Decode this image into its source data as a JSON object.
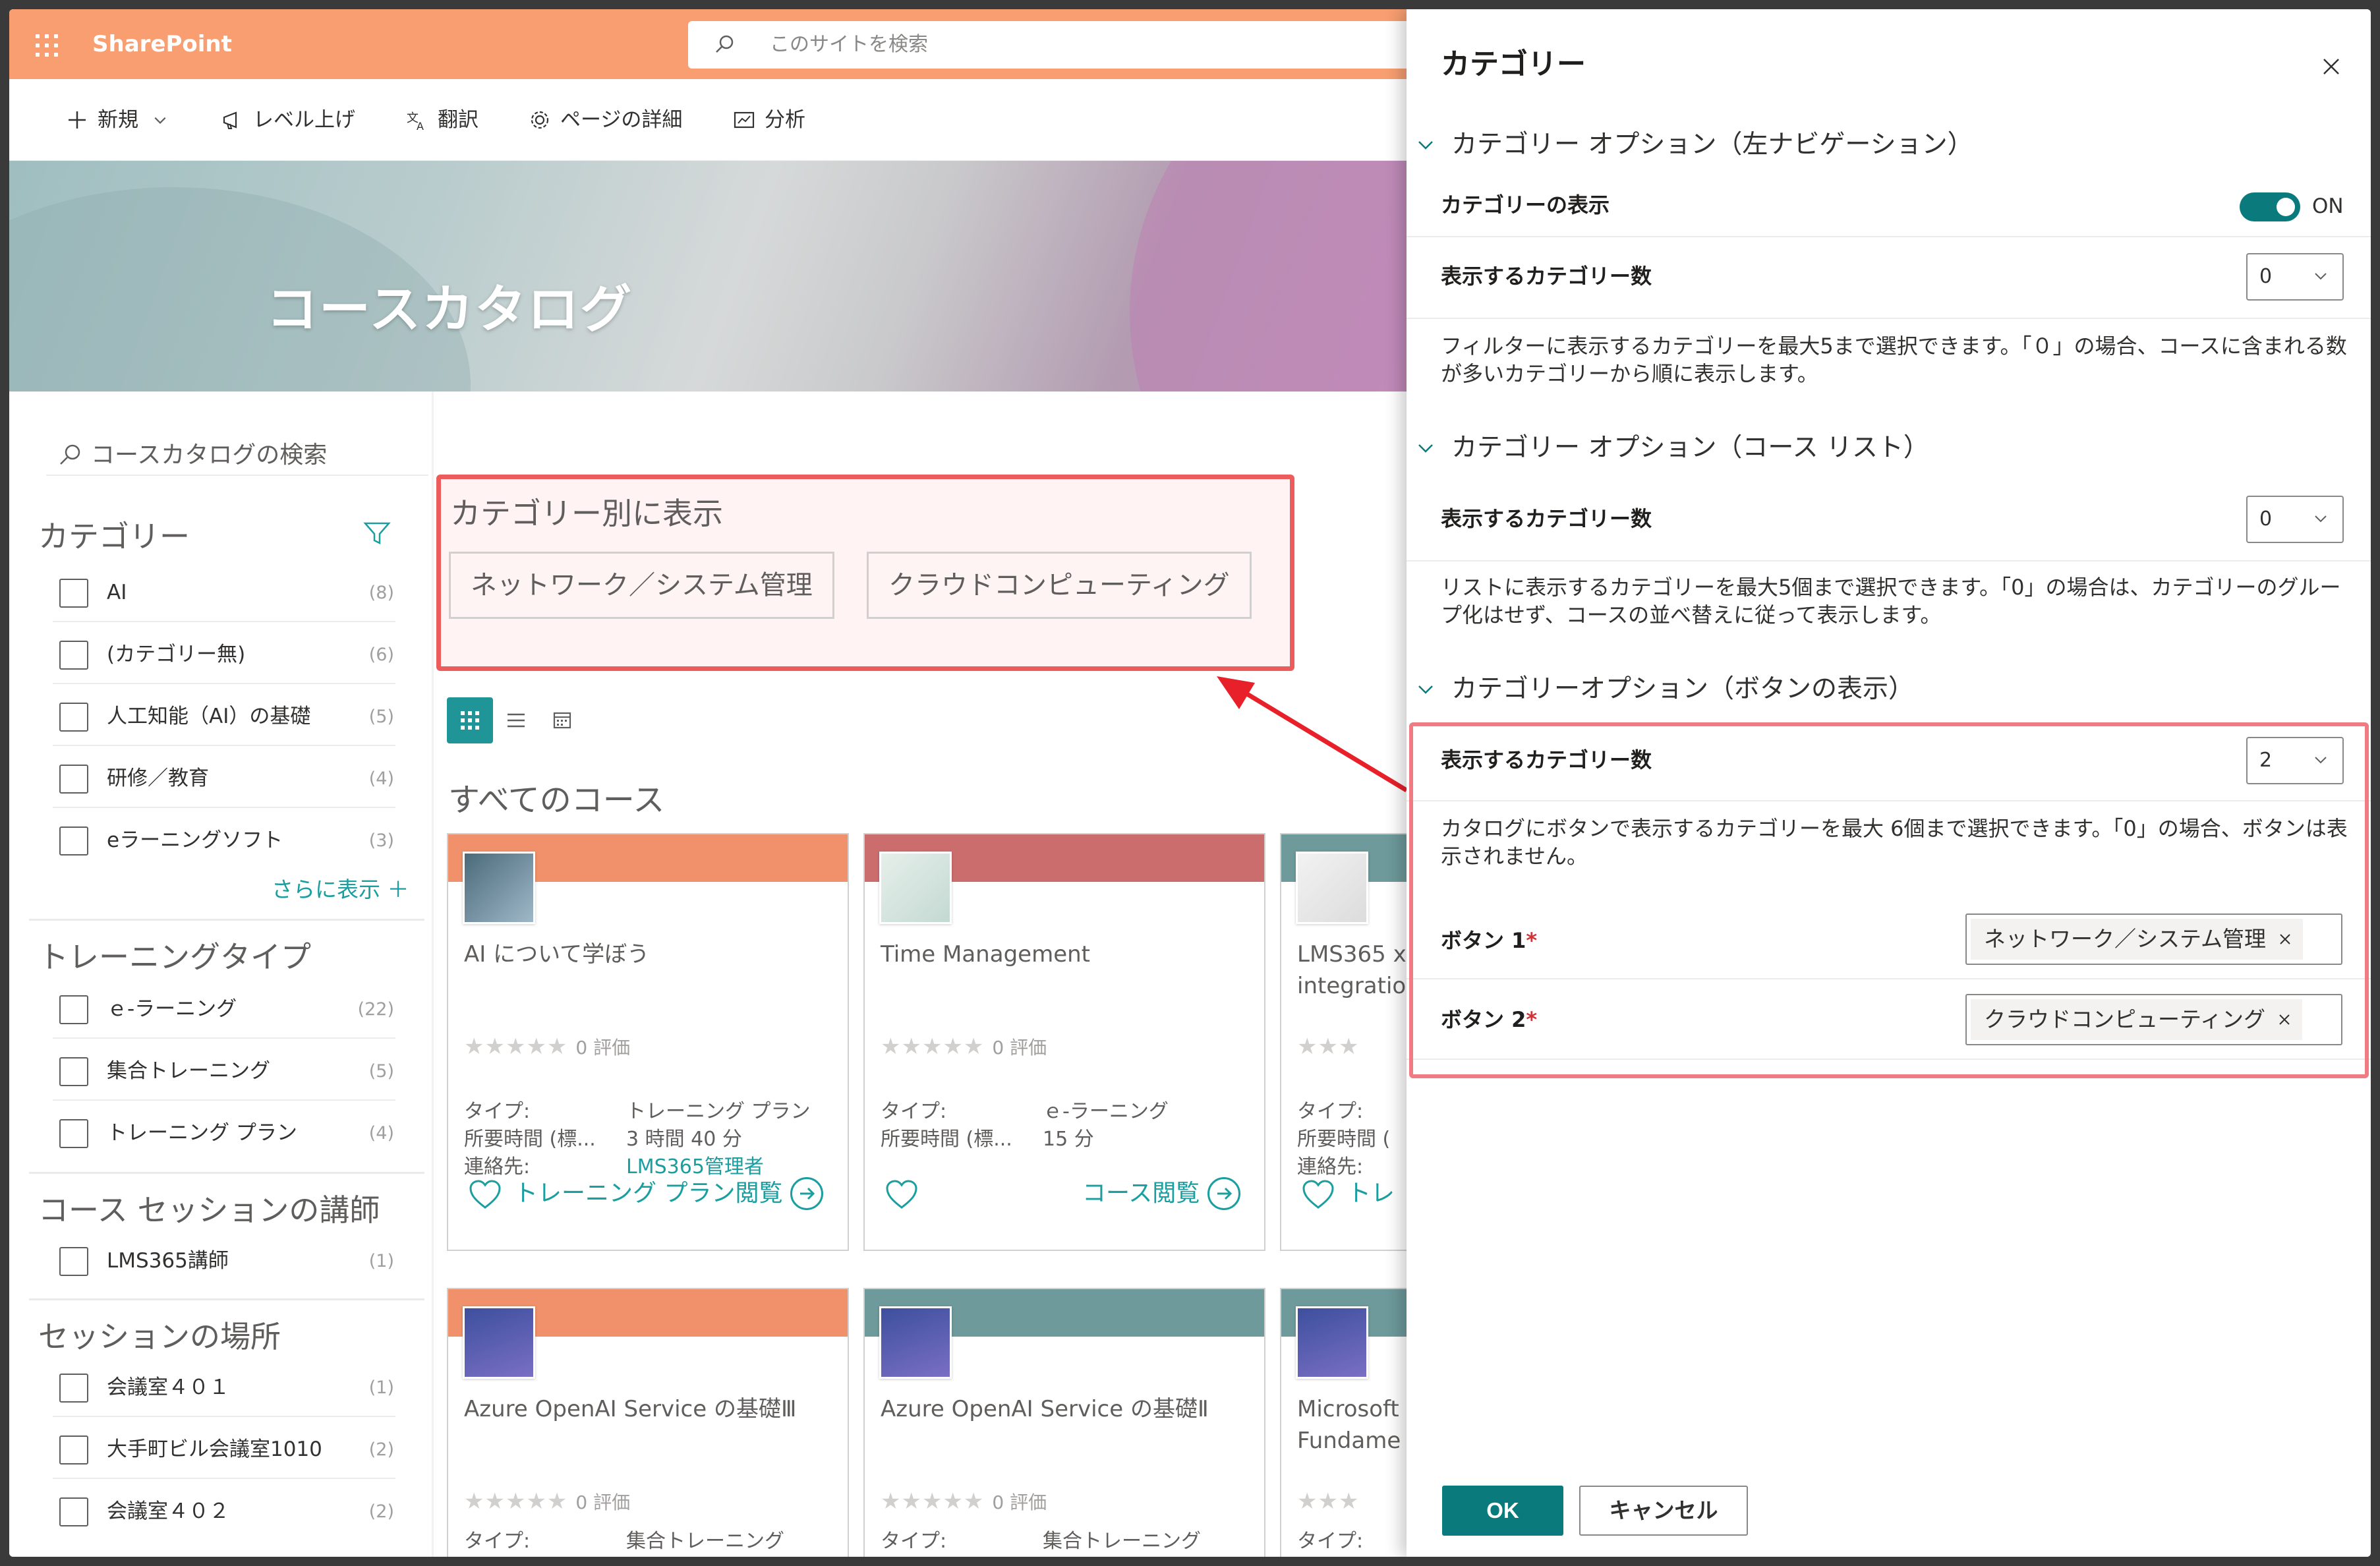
{
  "suitebar": {
    "app_name": "SharePoint",
    "search_placeholder": "このサイトを検索"
  },
  "commandbar": {
    "new": "新規",
    "promote": "レベル上げ",
    "translate": "翻訳",
    "page_details": "ページの詳細",
    "analytics": "分析"
  },
  "hero": {
    "title": "コースカタログ"
  },
  "leftpanel": {
    "search_placeholder": "コースカタログの検索",
    "sections": [
      {
        "title": "カテゴリー",
        "items": [
          {
            "label": "AI",
            "count": "(8)"
          },
          {
            "label": "(カテゴリー無)",
            "count": "(6)"
          },
          {
            "label": "人工知能（AI）の基礎",
            "count": "(5)"
          },
          {
            "label": "研修／教育",
            "count": "(4)"
          },
          {
            "label": "eラーニングソフト",
            "count": "(3)"
          }
        ],
        "more": "さらに表示 ＋"
      },
      {
        "title": "トレーニングタイプ",
        "items": [
          {
            "label": "ｅ-ラーニング",
            "count": "(22)"
          },
          {
            "label": "集合トレーニング",
            "count": "(5)"
          },
          {
            "label": "トレーニング プラン",
            "count": "(4)"
          }
        ]
      },
      {
        "title": "コース セッションの講師",
        "items": [
          {
            "label": "LMS365講師",
            "count": "(1)"
          }
        ]
      },
      {
        "title": "セッションの場所",
        "items": [
          {
            "label": "会議室４０１",
            "count": "(1)"
          },
          {
            "label": "大手町ビル会議室1010",
            "count": "(2)"
          },
          {
            "label": "会議室４０２",
            "count": "(2)"
          }
        ]
      }
    ]
  },
  "main": {
    "category_title": "カテゴリー別に表示",
    "category_buttons": [
      "ネットワーク／システム管理",
      "クラウドコンピューティング"
    ],
    "all_courses": "すべてのコース",
    "cards": [
      {
        "name": "AI について学ぼう",
        "band": "#f0916b",
        "rating": "0 評価",
        "type_label": "タイプ:",
        "type": "トレーニング プラン",
        "duration_label": "所要時間 (標...",
        "duration": "3 時間 40 分",
        "contact_label": "連絡先:",
        "contact": "LMS365管理者",
        "action": "トレーニング プラン閲覧"
      },
      {
        "name": "Time Management",
        "band": "#cc6d6d",
        "rating": "0 評価",
        "type_label": "タイプ:",
        "type": "ｅ-ラーニング",
        "duration_label": "所要時間 (標...",
        "duration": "15 分",
        "action": "コース閲覧"
      },
      {
        "name": "LMS365 x",
        "name2": "integratio",
        "band": "#6e9a9b",
        "rating": "",
        "type_label": "タイプ:",
        "duration_label": "所要時間 (",
        "contact_label": "連絡先:",
        "action": "トレ"
      },
      {
        "name": "Azure OpenAI Service の基礎Ⅲ",
        "band": "#f0916b",
        "rating": "0 評価",
        "type_label": "タイプ:",
        "type": "集合トレーニング"
      },
      {
        "name": "Azure OpenAI Service の基礎Ⅱ",
        "band": "#6e9a9b",
        "rating": "0 評価",
        "type_label": "タイプ:",
        "type": "集合トレーニング"
      },
      {
        "name": "Microsoft",
        "name2": "Fundame",
        "band": "#6e9a9b",
        "rating": "",
        "type_label": "タイプ:"
      }
    ]
  },
  "panel": {
    "title": "カテゴリー",
    "group1": "カテゴリー オプション（左ナビゲーション）",
    "show_categories_label": "カテゴリーの表示",
    "toggle_state": "ON",
    "count_label": "表示するカテゴリー数",
    "dd1_value": "0",
    "desc1": "フィルターに表示するカテゴリーを最大5まで選択できます。「０」の場合、コースに含まれる数が多いカテゴリーから順に表示します。",
    "group2": "カテゴリー オプション（コース リスト）",
    "dd2_value": "0",
    "desc2": "リストに表示するカテゴリーを最大5個まで選択できます。「0」の場合は、カテゴリーのグループ化はせず、コースの並べ替えに従って表示します。",
    "group3": "カテゴリーオプション（ボタンの表示）",
    "dd3_value": "2",
    "desc3": "カタログにボタンで表示するカテゴリーを最大 6個まで選択できます。「0」の場合、ボタンは表示されません。",
    "button1_label": "ボタン 1",
    "button1_value": "ネットワーク／システム管理",
    "button2_label": "ボタン 2",
    "button2_value": "クラウドコンピューティング",
    "required_mark": "*",
    "ok": "OK",
    "cancel": "キャンセル"
  },
  "colors": {
    "accent": "#0b7a7c",
    "suitebar": "#f89e71",
    "highlight": "#ed5c5c"
  }
}
